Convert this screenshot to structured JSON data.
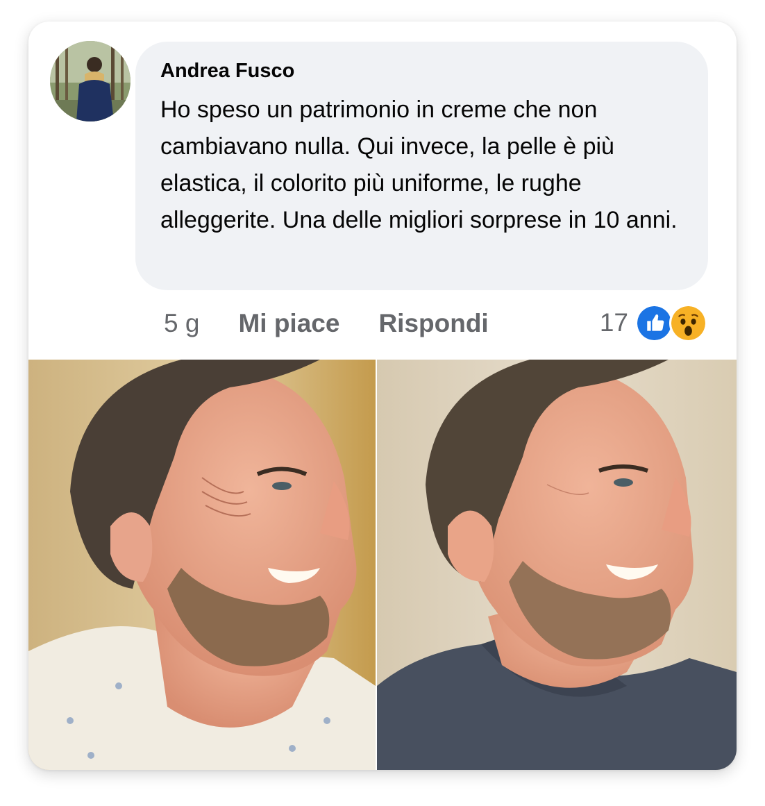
{
  "comment": {
    "author": "Andrea Fusco",
    "text": "Ho speso un patrimonio in creme che non cambiavano nulla. Qui invece, la pelle è più elastica, il colorito più uniforme, le rughe alleggerite. Una delle migliori sorprese in 10 anni.",
    "time": "5 g",
    "like_label": "Mi piace",
    "reply_label": "Rispondi",
    "reaction_count": "17",
    "reactions": [
      "like-icon",
      "wow-icon"
    ]
  },
  "colors": {
    "bubble": "#f0f2f5",
    "like_blue": "#1b74e4",
    "wow_yellow": "#f7b125",
    "muted_text": "#65676b"
  },
  "photos": [
    {
      "subject": "before-photo",
      "shirt": "white floral shirt"
    },
    {
      "subject": "after-photo",
      "shirt": "navy t-shirt"
    }
  ]
}
